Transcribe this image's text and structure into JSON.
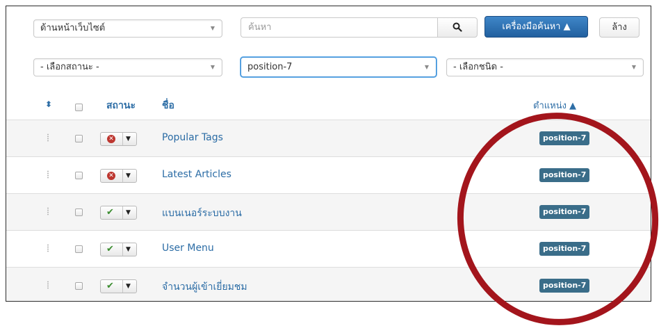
{
  "filters": {
    "site_select": "ด้านหน้าเว็บไซต์",
    "search_placeholder": "ค้นหา",
    "tools_label": "เครื่องมือค้นหา ▲",
    "clear_label": "ล้าง",
    "status_select": "- เลือกสถานะ -",
    "position_select": "position-7",
    "type_select": "- เลือกชนิด -"
  },
  "table": {
    "headers": {
      "ordering": "⬍",
      "status": "สถานะ",
      "title": "ชื่อ",
      "position": "ตำแหน่ง ▲"
    },
    "rows": [
      {
        "title": "Popular Tags",
        "status": "unpublished",
        "position": "position-7"
      },
      {
        "title": "Latest Articles",
        "status": "unpublished",
        "position": "position-7"
      },
      {
        "title": "แบนเนอร์ระบบงาน",
        "status": "published",
        "position": "position-7"
      },
      {
        "title": "User Menu",
        "status": "published",
        "position": "position-7"
      },
      {
        "title": "จำนวนผู้เข้าเยี่ยมชม",
        "status": "published",
        "position": "position-7"
      }
    ]
  },
  "colors": {
    "link": "#2b6ca5",
    "primary_button": "#2c6fb3",
    "badge": "#3a6d89",
    "unpublished": "#bd362f",
    "published": "#3b8c2f",
    "annotation_circle": "#a3151c"
  }
}
